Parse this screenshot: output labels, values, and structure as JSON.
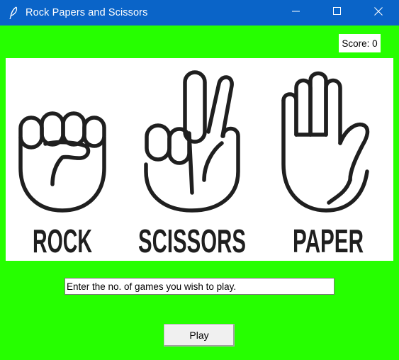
{
  "window": {
    "title": "Rock Papers and Scissors",
    "background_color": "#26ff00",
    "titlebar_color": "#0a64c8",
    "controls": [
      "minimize-icon",
      "maximize-icon",
      "close-icon"
    ]
  },
  "score": {
    "label": "Score: 0"
  },
  "banner": {
    "labels": [
      "ROCK",
      "SCISSORS",
      "PAPER"
    ],
    "icons": [
      "fist-hand-icon",
      "peace-hand-icon",
      "open-palm-hand-icon"
    ]
  },
  "games_input": {
    "value": "Enter the no. of games you wish to play."
  },
  "play_button": {
    "label": "Play"
  }
}
